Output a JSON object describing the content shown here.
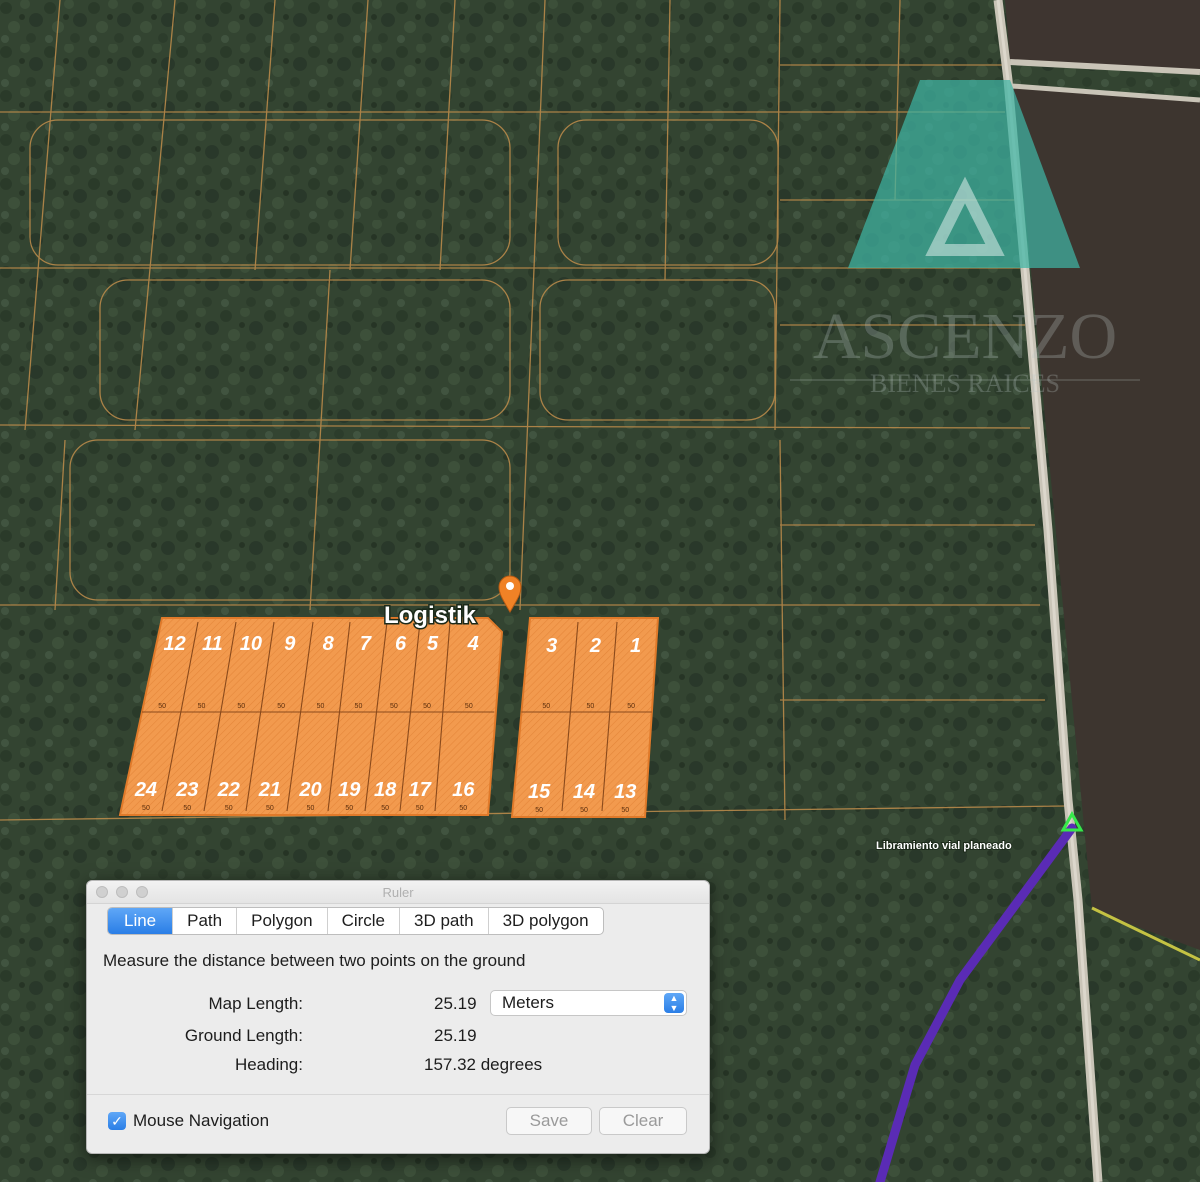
{
  "map": {
    "place_label": "Logistik",
    "road_label": "Libramiento vial planeado",
    "lots_north": [
      "12",
      "11",
      "10",
      "9",
      "8",
      "7",
      "6",
      "5",
      "4",
      "3",
      "2",
      "1"
    ],
    "lots_south": [
      "24",
      "23",
      "22",
      "21",
      "20",
      "19",
      "18",
      "17",
      "16",
      "15",
      "14",
      "13"
    ],
    "lot_dimension": "50",
    "colors": {
      "lot_fill": "#f29a4e",
      "lot_border": "#e07a2a",
      "parcel_lines": "#b8894a",
      "route": "#5a2bb5",
      "pin": "#f08226"
    }
  },
  "watermark": {
    "brand": "ASCENZO",
    "tagline": "BIENES RAICES",
    "logo": "triangle-logo",
    "color": "#3fb4a3"
  },
  "ruler": {
    "title": "Ruler",
    "tabs": [
      "Line",
      "Path",
      "Polygon",
      "Circle",
      "3D path",
      "3D polygon"
    ],
    "active_tab": "Line",
    "description": "Measure the distance between two points on the ground",
    "map_length_label": "Map Length:",
    "map_length_value": "25.19",
    "unit": "Meters",
    "ground_length_label": "Ground Length:",
    "ground_length_value": "25.19",
    "heading_label": "Heading:",
    "heading_value": "157.32 degrees",
    "mouse_navigation_label": "Mouse Navigation",
    "mouse_navigation_checked": true,
    "save_label": "Save",
    "clear_label": "Clear",
    "accent": "#2a7ee6"
  }
}
